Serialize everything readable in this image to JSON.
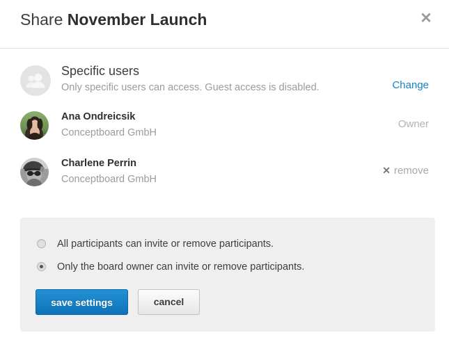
{
  "dialog": {
    "title_prefix": "Share ",
    "title_main": "November Launch",
    "close_label": "✕"
  },
  "access": {
    "icon": "group-users-icon",
    "title": "Specific users",
    "description": "Only specific users can access. Guest access is disabled.",
    "change_label": "Change"
  },
  "members": [
    {
      "name": "Ana Ondreicsik",
      "organization": "Conceptboard GmbH",
      "action_label": "Owner",
      "action_type": "owner"
    },
    {
      "name": "Charlene Perrin",
      "organization": "Conceptboard GmbH",
      "action_label": "remove",
      "action_icon": "✕",
      "action_type": "remove"
    }
  ],
  "permissions": {
    "options": [
      {
        "label": "All participants can invite or remove participants.",
        "selected": false
      },
      {
        "label": "Only the board owner can invite or remove participants.",
        "selected": true
      }
    ]
  },
  "buttons": {
    "save_label": "save settings",
    "cancel_label": "cancel"
  },
  "colors": {
    "accent_blue": "#1281cc",
    "save_button_blue": "#0f72b8",
    "panel_gray": "#efefef",
    "muted_text": "#9b9b9b"
  }
}
